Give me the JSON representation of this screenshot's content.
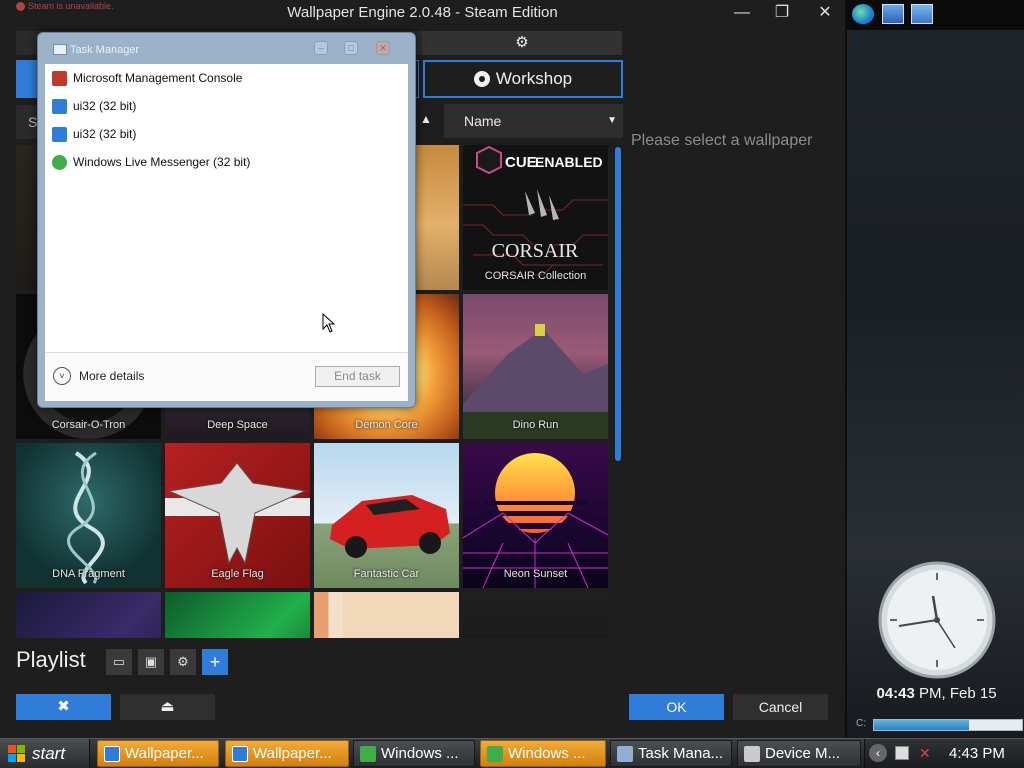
{
  "window": {
    "title": "Wallpaper Engine 2.0.48 - Steam Edition",
    "steam_warning": "Steam is unavailable.",
    "controls": {
      "minimize": "—",
      "maximize": "❐",
      "close": "✕"
    }
  },
  "tabs": {
    "settings_icon": "gear-icon",
    "workshop": "Workshop"
  },
  "toolbar": {
    "search_letter": "S",
    "sort_value": "Name"
  },
  "preview": {
    "placeholder": "Please select a wallpaper"
  },
  "wallpapers": [
    {
      "label": ""
    },
    {
      "label": ""
    },
    {
      "label": ""
    },
    {
      "label": "CORSAIR Collection",
      "badge_cue": "CUE",
      "badge_enabled": "ENABLED",
      "brand": "CORSAIR"
    },
    {
      "label": "Corsair-O-Tron"
    },
    {
      "label": "Deep Space"
    },
    {
      "label": "Demon Core"
    },
    {
      "label": "Dino Run"
    },
    {
      "label": "DNA Fragment"
    },
    {
      "label": "Eagle Flag"
    },
    {
      "label": "Fantastic Car"
    },
    {
      "label": "Neon Sunset"
    },
    {
      "label": ""
    },
    {
      "label": ""
    },
    {
      "label": ""
    },
    {
      "label": ""
    }
  ],
  "playlist": {
    "label": "Playlist",
    "buttons": [
      "folder-icon",
      "save-icon",
      "settings-icon",
      "add-icon"
    ],
    "add_symbol": "+"
  },
  "footer": {
    "ok": "OK",
    "cancel": "Cancel"
  },
  "task_manager": {
    "title": "Task Manager",
    "apps": [
      {
        "name": "Microsoft Management Console",
        "icon": "mmc-icon",
        "color": "#c0392b"
      },
      {
        "name": "ui32 (32 bit)",
        "icon": "ui32-icon",
        "color": "#2f7dd8"
      },
      {
        "name": "ui32 (32 bit)",
        "icon": "ui32-icon",
        "color": "#2f7dd8"
      },
      {
        "name": "Windows Live Messenger (32 bit)",
        "icon": "messenger-icon",
        "color": "#3fae49"
      }
    ],
    "more_details": "More details",
    "end_task": "End task"
  },
  "sidebar": {
    "time_bold": "04:43",
    "time_rest": " PM, Feb 15",
    "drive_label": "C:",
    "drive_used_fraction": 0.64
  },
  "taskbar": {
    "start": "start",
    "items": [
      {
        "label": "Wallpaper...",
        "style": "orange",
        "icon_color": "#2f7dd8"
      },
      {
        "label": "Wallpaper...",
        "style": "orange",
        "icon_color": "#2f7dd8"
      },
      {
        "label": "Windows ...",
        "style": "dark",
        "icon_color": "#3fae49"
      },
      {
        "label": "Windows ...",
        "style": "orange",
        "icon_color": "#3fae49"
      },
      {
        "label": "Task Mana...",
        "style": "dark",
        "icon_color": "#8fb0d0"
      },
      {
        "label": "Device M...",
        "style": "dark",
        "icon_color": "#c9c9c9"
      }
    ],
    "clock": "4:43 PM"
  },
  "colors": {
    "accent": "#2f7dd8",
    "taskbar_active": "#e8961f"
  }
}
